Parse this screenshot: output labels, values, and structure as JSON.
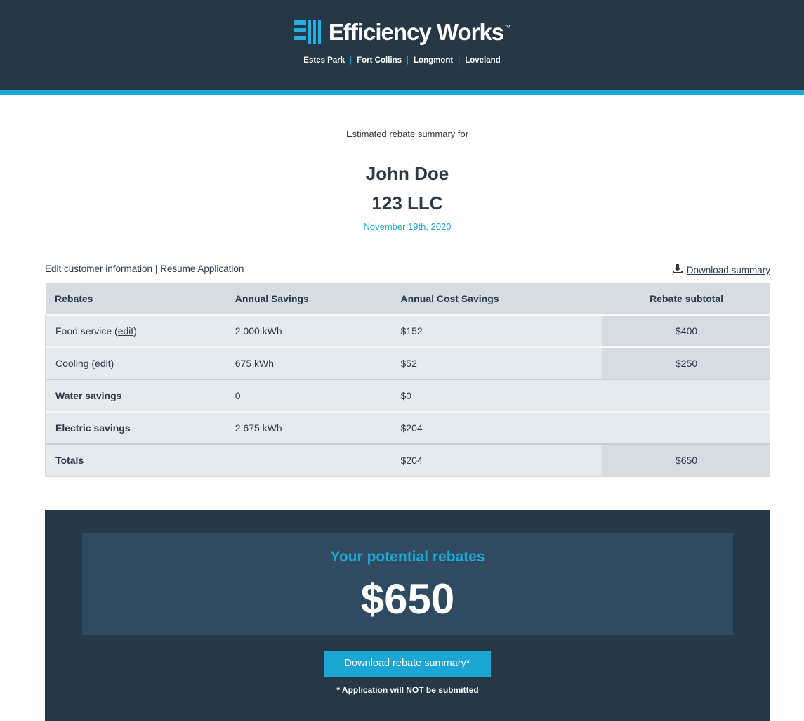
{
  "header": {
    "brand": "Efficiency Works",
    "trademark": "™",
    "cities": [
      "Estes Park",
      "Fort Collins",
      "Longmont",
      "Loveland"
    ],
    "city_separator": "|"
  },
  "summary": {
    "intro": "Estimated rebate summary for",
    "customer_name": "John Doe",
    "company": "123 LLC",
    "date": "November 19th, 2020"
  },
  "links": {
    "edit_customer": "Edit customer information",
    "separator": "|",
    "resume": "Resume Application",
    "download_icon": "download-icon",
    "download": "Download summary"
  },
  "table": {
    "headers": [
      "Rebates",
      "Annual Savings",
      "Annual Cost Savings",
      "Rebate subtotal"
    ],
    "rows": [
      {
        "label": "Food service",
        "edit": "edit",
        "savings": "2,000 kWh",
        "cost": "$152",
        "subtotal": "$400"
      },
      {
        "label": "Cooling",
        "edit": "edit",
        "savings": "675 kWh",
        "cost": "$52",
        "subtotal": "$250"
      },
      {
        "label": "Water savings",
        "savings": "0",
        "cost": "$0",
        "subtotal": ""
      },
      {
        "label": "Electric savings",
        "savings": "2,675 kWh",
        "cost": "$204",
        "subtotal": ""
      },
      {
        "label": "Totals",
        "savings": "",
        "cost": "$204",
        "subtotal": "$650"
      }
    ]
  },
  "panel": {
    "title": "Your potential rebates",
    "amount": "$650",
    "button": "Download rebate summary*",
    "note": "* Application will NOT be submitted"
  },
  "colors": {
    "header_bg": "#263746",
    "accent": "#1ba6d4",
    "panel_inner": "#304a61"
  }
}
